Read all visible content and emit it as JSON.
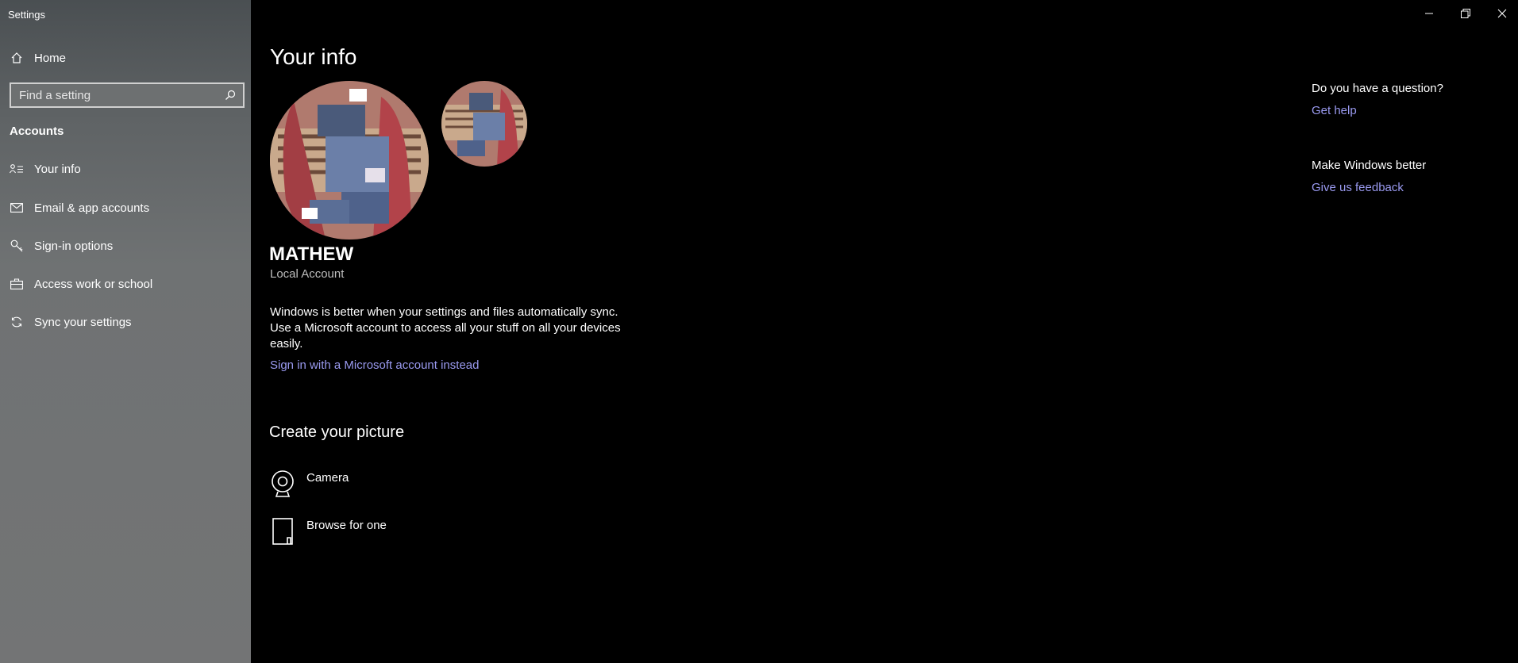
{
  "window": {
    "title": "Settings",
    "minimize_glyph": "—",
    "restore_glyph": "❐",
    "close_glyph": "✕"
  },
  "sidebar": {
    "home_label": "Home",
    "home_icon": "home-icon",
    "search_placeholder": "Find a setting",
    "section_label": "Accounts",
    "items": [
      {
        "label": "Your info",
        "icon": "contact-info-icon"
      },
      {
        "label": "Email & app accounts",
        "icon": "mail-icon"
      },
      {
        "label": "Sign-in options",
        "icon": "key-icon"
      },
      {
        "label": "Access work or school",
        "icon": "briefcase-icon"
      },
      {
        "label": "Sync your settings",
        "icon": "sync-icon"
      }
    ]
  },
  "main": {
    "title": "Your info",
    "username": "MATHEW",
    "account_type": "Local Account",
    "description": "Windows is better when your settings and files automatically sync. Use a Microsoft account to access all your stuff on all your devices easily.",
    "signin_link": "Sign in with a Microsoft account instead",
    "create_title": "Create your picture",
    "options": [
      {
        "label": "Camera",
        "icon": "camera-icon"
      },
      {
        "label": "Browse for one",
        "icon": "browse-file-icon"
      }
    ]
  },
  "help": {
    "question": "Do you have a question?",
    "get_help": "Get help",
    "better": "Make Windows better",
    "feedback": "Give us feedback"
  },
  "colors": {
    "accent_link": "#9a9af0",
    "sidebar_bg": "#737475",
    "main_bg": "#000000"
  }
}
